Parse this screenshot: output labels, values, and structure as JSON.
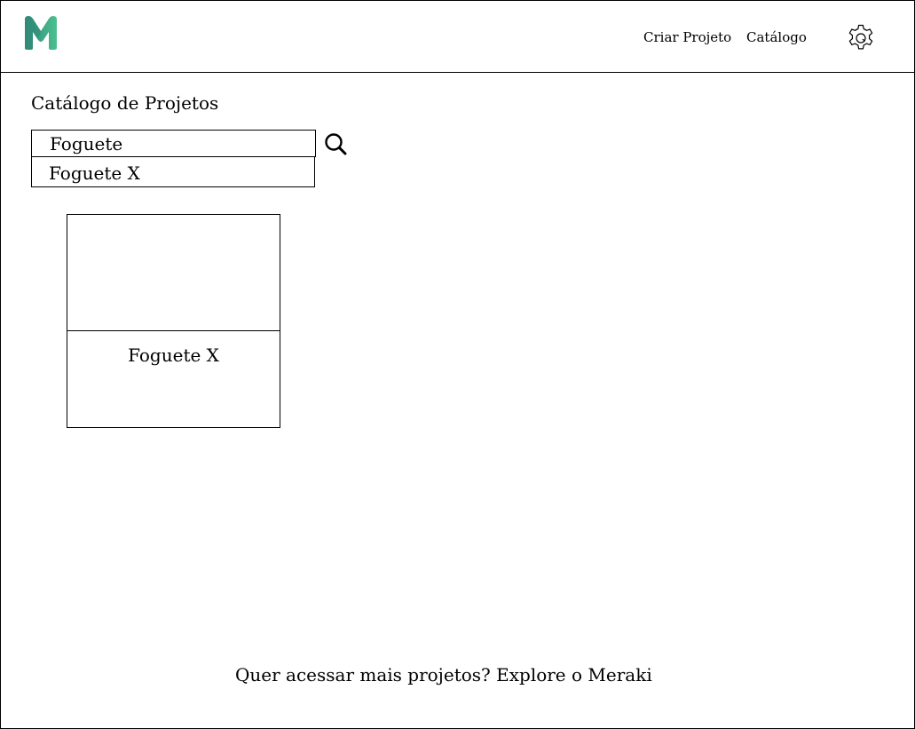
{
  "header": {
    "logo_icon": "meraki-m-logo-icon",
    "nav": {
      "create_project": "Criar Projeto",
      "catalog": "Catálogo"
    },
    "settings_icon": "gear-icon"
  },
  "main": {
    "title": "Catálogo de Projetos",
    "search": {
      "value": "Foguete",
      "icon": "search-icon",
      "suggestions": [
        "Foguete X"
      ]
    },
    "cards": [
      {
        "title": "Foguete X"
      }
    ]
  },
  "footer": {
    "text": "Quer acessar mais projetos? Explore o Meraki"
  },
  "colors": {
    "logo_dark": "#2f8a76",
    "logo_light": "#4cbf91"
  }
}
